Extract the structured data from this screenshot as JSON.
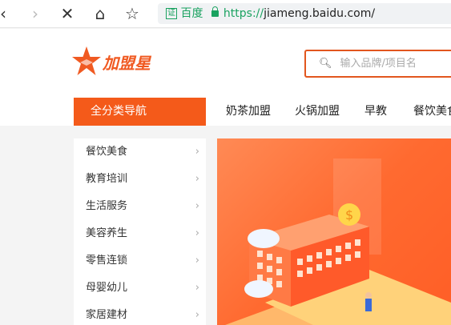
{
  "browser": {
    "cert_label": "证",
    "site_label": "百度",
    "url_scheme": "https://",
    "url_host": "jiameng.baidu.com/"
  },
  "logo": {
    "text": "加盟星"
  },
  "search": {
    "placeholder": "输入品牌/项目名"
  },
  "nav": {
    "all_label": "全分类导航",
    "items": [
      "奶茶加盟",
      "火锅加盟",
      "早教",
      "餐饮美食"
    ]
  },
  "sidebar": {
    "items": [
      "餐饮美食",
      "教育培训",
      "生活服务",
      "美容养生",
      "零售连锁",
      "母婴幼儿",
      "家居建材"
    ]
  },
  "colors": {
    "brand": "#f45a1a",
    "secure": "#1aa260"
  }
}
